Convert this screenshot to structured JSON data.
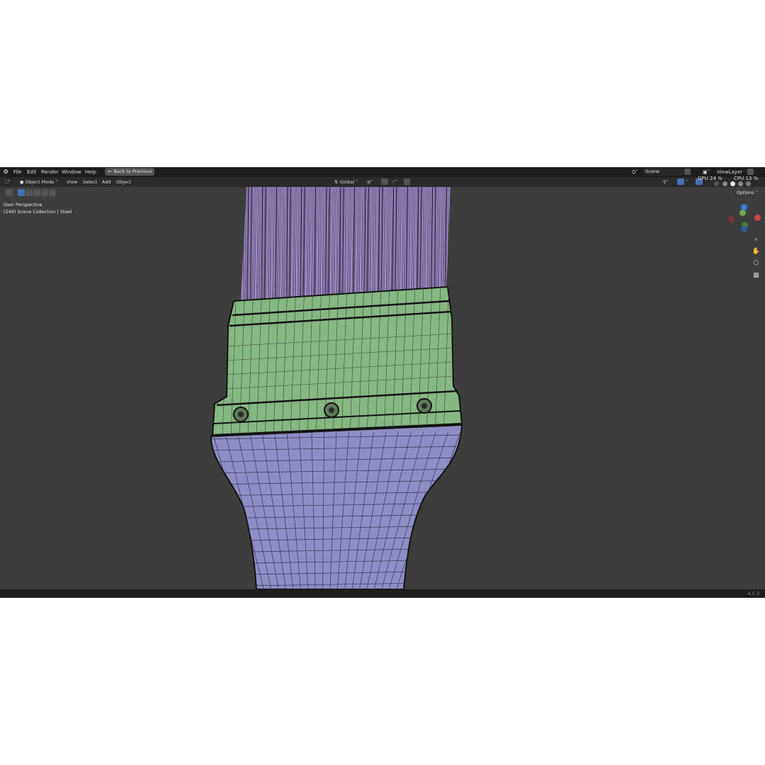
{
  "menu": {
    "file": "File",
    "edit": "Edit",
    "render": "Render",
    "window": "Window",
    "help": "Help",
    "back_to_previous": "Back to Previous"
  },
  "scene": {
    "label": "Scene"
  },
  "view_layer": {
    "label": "ViewLayer"
  },
  "header": {
    "mode": "Object Mode",
    "view": "View",
    "select": "Select",
    "add": "Add",
    "object": "Object",
    "transform_orientation": "Global",
    "options": "Options"
  },
  "stats": {
    "gpu_label": "GPU",
    "gpu_value": "24 %",
    "cpu_label": "CPU",
    "cpu_value": "13 %"
  },
  "viewport": {
    "perspective": "User Perspective",
    "collection": "(249) Scene Collection | Steel"
  },
  "status_bar": {
    "version": "4.5.3"
  },
  "colors": {
    "bristles": "#8c78b4",
    "ferrule": "#86b882",
    "handle": "#8f8ec4",
    "viewport_bg": "#3d3d3d"
  }
}
